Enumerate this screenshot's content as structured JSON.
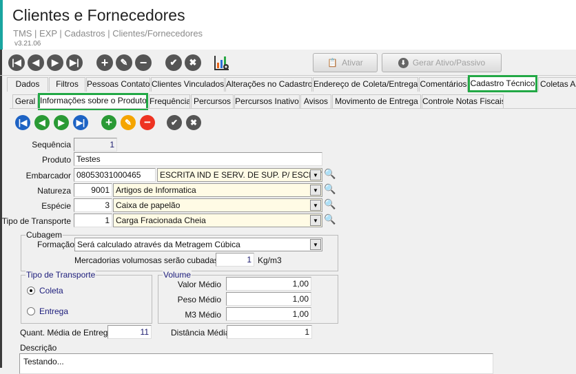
{
  "header": {
    "title": "Clientes e Fornecedores",
    "breadcrumb": "TMS | EXP | Cadastros | Clientes/Fornecedores",
    "version": "v3.21.06"
  },
  "toolbar": {
    "ativar": "Ativar",
    "gerar": "Gerar Ativo/Passivo"
  },
  "tabs": [
    "Dados",
    "Filtros",
    "Pessoas Contato",
    "Clientes Vinculados",
    "Alterações no Cadastro",
    "Endereço de Coleta/Entrega",
    "Comentários",
    "Cadastro Técnico",
    "Coletas Au"
  ],
  "subtabs": [
    "Geral",
    "Informações sobre o Produto",
    "Frequência",
    "Percursos",
    "Percursos Inativo",
    "Avisos",
    "Movimento de Entrega",
    "Controle Notas Fiscais"
  ],
  "form": {
    "sequencia": {
      "label": "Sequência",
      "value": "1"
    },
    "produto": {
      "label": "Produto",
      "value": "Testes"
    },
    "embarcador": {
      "label": "Embarcador",
      "code": "08053031000465",
      "name": "ESCRITA IND E SERV. DE SUP. P/ ESCRITORI"
    },
    "natureza": {
      "label": "Natureza",
      "code": "9001",
      "name": "Artigos de Informatica"
    },
    "especie": {
      "label": "Espécie",
      "code": "3",
      "name": "Caixa de papelão"
    },
    "tipo_transporte": {
      "label": "Tipo de Transporte",
      "code": "1",
      "name": "Carga Fracionada Cheia"
    },
    "cubagem": {
      "title": "Cubagem",
      "formacao_label": "Formação",
      "formacao": "Será calculado através da Metragem Cúbica",
      "merc_label": "Mercadorias volumosas serão cubadas a",
      "merc_value": "1",
      "unit": "Kg/m3"
    },
    "tipo_group": {
      "title": "Tipo de Transporte",
      "coleta": "Coleta",
      "entrega": "Entrega"
    },
    "volume": {
      "title": "Volume",
      "valor_label": "Valor Médio",
      "valor": "1,00",
      "peso_label": "Peso Médio",
      "peso": "1,00",
      "m3_label": "M3 Médio",
      "m3": "1,00"
    },
    "quant": {
      "label": "Quant. Média de Entregas",
      "value": "11"
    },
    "distancia": {
      "label": "Distância Média",
      "value": "1"
    },
    "descricao": {
      "label": "Descrição",
      "value": "Testando..."
    }
  }
}
